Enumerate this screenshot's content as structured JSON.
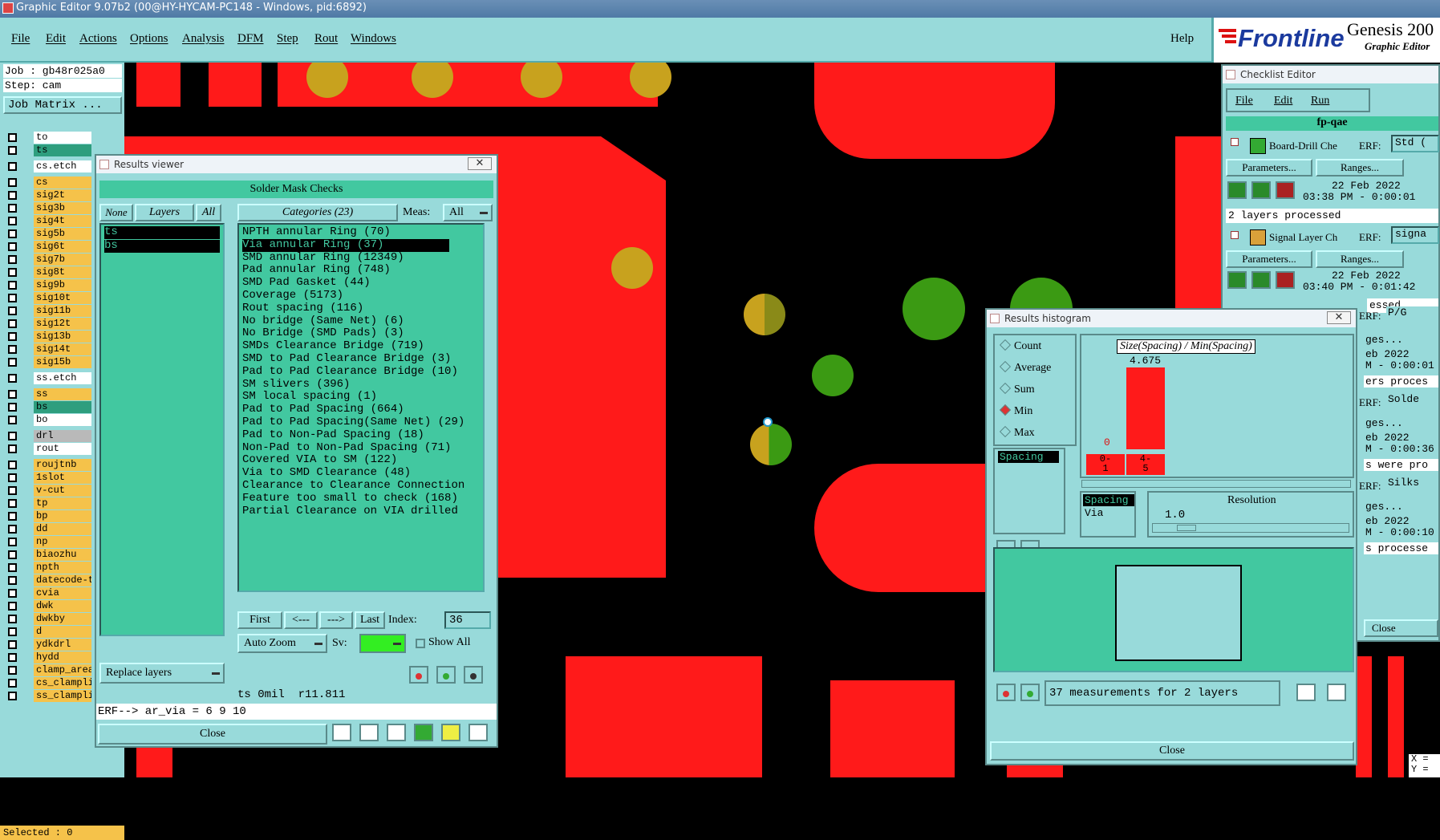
{
  "window_title": "Graphic Editor 9.07b2 (00@HY-HYCAM-PC148 - Windows, pid:6892)",
  "menu": [
    "File",
    "Edit",
    "Actions",
    "Options",
    "Analysis",
    "DFM",
    "Step",
    "Rout",
    "Windows"
  ],
  "help": "Help",
  "logo": {
    "brand": "Frontline",
    "product": "Genesis 200",
    "subtitle": "Graphic Editor"
  },
  "job": {
    "job_label": "Job : gb48r025a0",
    "step_label": "Step: cam",
    "matrix_button": "Job Matrix ..."
  },
  "layers": [
    {
      "name": "to",
      "style": "w"
    },
    {
      "name": "ts",
      "style": "g"
    },
    {
      "name": "cs.etch",
      "style": "w"
    },
    {
      "name": "cs",
      "style": "y"
    },
    {
      "name": "sig2t",
      "style": "y"
    },
    {
      "name": "sig3b",
      "style": "y"
    },
    {
      "name": "sig4t",
      "style": "y"
    },
    {
      "name": "sig5b",
      "style": "y"
    },
    {
      "name": "sig6t",
      "style": "y"
    },
    {
      "name": "sig7b",
      "style": "y"
    },
    {
      "name": "sig8t",
      "style": "y"
    },
    {
      "name": "sig9b",
      "style": "y"
    },
    {
      "name": "sig10t",
      "style": "y"
    },
    {
      "name": "sig11b",
      "style": "y"
    },
    {
      "name": "sig12t",
      "style": "y"
    },
    {
      "name": "sig13b",
      "style": "y"
    },
    {
      "name": "sig14t",
      "style": "y"
    },
    {
      "name": "sig15b",
      "style": "y"
    },
    {
      "name": "ss.etch",
      "style": "w"
    },
    {
      "name": "ss",
      "style": "y"
    },
    {
      "name": "bs",
      "style": "g"
    },
    {
      "name": "bo",
      "style": "w"
    },
    {
      "name": "drl",
      "style": "gray"
    },
    {
      "name": "rout",
      "style": "w"
    },
    {
      "name": "roujtnb",
      "style": "y"
    },
    {
      "name": "1slot",
      "style": "y"
    },
    {
      "name": "v-cut",
      "style": "y"
    },
    {
      "name": "tp",
      "style": "y"
    },
    {
      "name": "bp",
      "style": "y"
    },
    {
      "name": "dd",
      "style": "y"
    },
    {
      "name": "np",
      "style": "y"
    },
    {
      "name": "biaozhu",
      "style": "y"
    },
    {
      "name": "npth",
      "style": "y"
    },
    {
      "name": "datecode-t",
      "style": "y"
    },
    {
      "name": "cvia",
      "style": "y"
    },
    {
      "name": "dwk",
      "style": "y"
    },
    {
      "name": "dwkby",
      "style": "y"
    },
    {
      "name": "d",
      "style": "y"
    },
    {
      "name": "ydkdrl",
      "style": "y"
    },
    {
      "name": "hydd",
      "style": "y"
    },
    {
      "name": "clamp_area",
      "style": "y"
    },
    {
      "name": "cs_clampli",
      "style": "y"
    },
    {
      "name": "ss_clampli",
      "style": "y"
    }
  ],
  "selected_label": "Selected : 0",
  "results_viewer": {
    "title": "Results viewer",
    "heading": "Solder Mask Checks",
    "none": "None",
    "layers": "Layers",
    "all": "All",
    "layer_items": [
      "ts",
      "bs"
    ],
    "categories_label": "Categories (23)",
    "meas_label": "Meas:",
    "meas_value": "All",
    "categories": [
      "NPTH annular Ring (70)",
      "Via annular Ring (37)",
      "SMD annular Ring (12349)",
      "Pad annular Ring (748)",
      "SMD Pad Gasket (44)",
      "Coverage (5173)",
      "Rout spacing (116)",
      "No bridge (Same Net) (6)",
      "No Bridge (SMD Pads) (3)",
      "SMDs Clearance Bridge (719)",
      "SMD to Pad Clearance Bridge (3)",
      "Pad to Pad Clearance Bridge (10)",
      "SM slivers (396)",
      "SM local spacing (1)",
      "Pad to Pad Spacing (664)",
      "Pad to Pad Spacing(Same Net) (29)",
      "Pad to Non-Pad Spacing (18)",
      "Non-Pad to Non-Pad Spacing (71)",
      "Covered VIA to SM (122)",
      "Via to SMD Clearance (48)",
      "Clearance to Clearance Connection",
      "Feature too small to check (168)",
      "Partial Clearance on VIA drilled"
    ],
    "first": "First",
    "prev": "<---",
    "next": "--->",
    "last": "Last",
    "index_label": "Index:",
    "index_value": "36",
    "auto_zoom": "Auto Zoom",
    "sv_label": "Sv:",
    "show_all": "Show All",
    "replace_layers": "Replace layers",
    "status": "ts 0mil  r11.811",
    "erf": "ERF--> ar_via = 6 9 10",
    "close": "Close"
  },
  "histogram": {
    "title": "Results histogram",
    "options": [
      "Count",
      "Average",
      "Sum",
      "Min",
      "Max"
    ],
    "selected_option": "Min",
    "chart_title": "Size(Spacing) / Min(Spacing)",
    "bar_value": "4.675",
    "zero_label": "0",
    "bins": [
      "0-\n1",
      "4-\n5"
    ],
    "spacing_item": "Spacing",
    "list2": [
      "Spacing",
      "Via"
    ],
    "resolution_label": "Resolution",
    "resolution_value": "1.0",
    "footer": "37 measurements for 2 layers",
    "close": "Close"
  },
  "checklist": {
    "title": "Checklist Editor",
    "menu": [
      "File",
      "Edit",
      "Run"
    ],
    "name": "fp-qae",
    "checks": [
      {
        "name": "Board-Drill Che",
        "erf": "Std (",
        "date": "22 Feb 2022",
        "time": "03:38 PM - 0:00:01",
        "status": "2 layers processed"
      },
      {
        "name": "Signal Layer Ch",
        "erf": "signa",
        "date": "22 Feb 2022",
        "time": "03:40 PM - 0:01:42",
        "status": "essed"
      }
    ],
    "params": "Parameters...",
    "ranges": "Ranges...",
    "partial": [
      "P/G",
      "ges...",
      "eb 2022",
      "M - 0:00:01",
      "ers proces",
      "Solde",
      "ges...",
      "eb 2022",
      "M - 0:00:36",
      "s were pro",
      "Silks",
      "ges...",
      "eb 2022",
      "M - 0:00:10",
      "s processe"
    ],
    "erf_label": "ERF:",
    "close": "Close"
  },
  "coords": {
    "x": "X =",
    "y": "Y ="
  }
}
